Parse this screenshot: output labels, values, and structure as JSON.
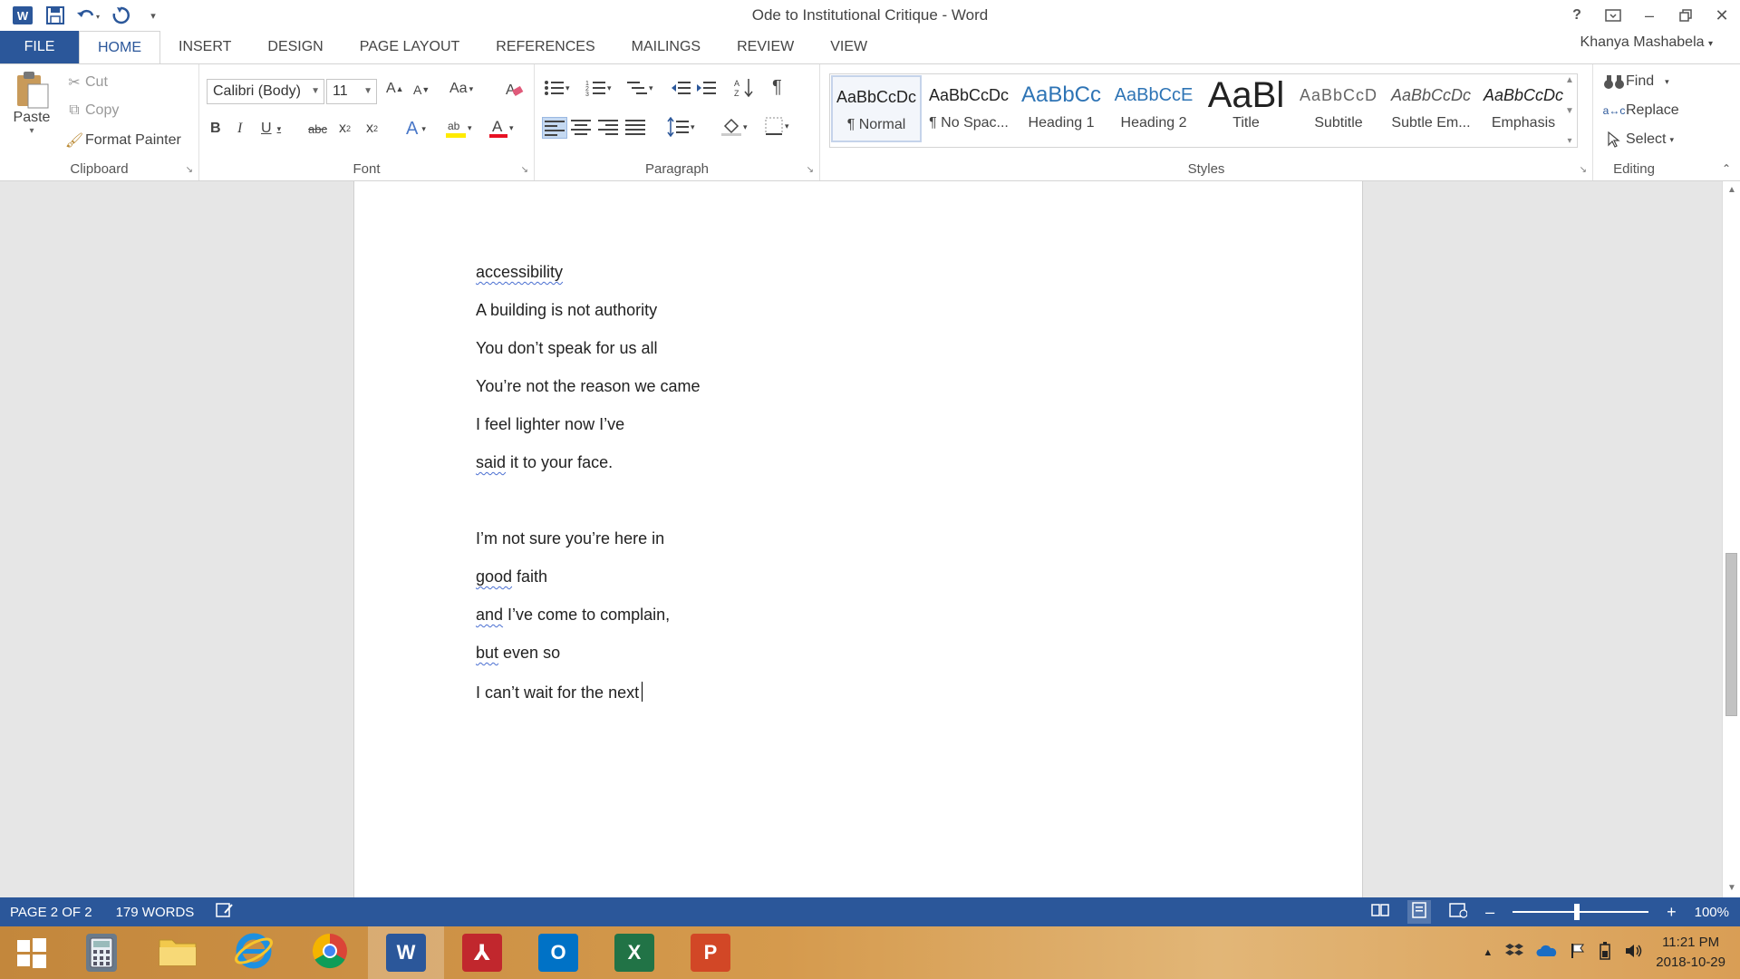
{
  "window": {
    "title": "Ode to Institutional Critique - Word",
    "user": "Khanya Mashabela"
  },
  "tabs": [
    {
      "label": "FILE"
    },
    {
      "label": "HOME"
    },
    {
      "label": "INSERT"
    },
    {
      "label": "DESIGN"
    },
    {
      "label": "PAGE LAYOUT"
    },
    {
      "label": "REFERENCES"
    },
    {
      "label": "MAILINGS"
    },
    {
      "label": "REVIEW"
    },
    {
      "label": "VIEW"
    }
  ],
  "clipboard": {
    "paste": "Paste",
    "cut": "Cut",
    "copy": "Copy",
    "format_painter": "Format Painter",
    "label": "Clipboard"
  },
  "font": {
    "name": "Calibri (Body)",
    "size": "11",
    "label": "Font"
  },
  "paragraph": {
    "label": "Paragraph"
  },
  "styles": {
    "label": "Styles",
    "items": [
      {
        "preview": "AaBbCcDc",
        "name": "¶ Normal"
      },
      {
        "preview": "AaBbCcDc",
        "name": "¶ No Spac..."
      },
      {
        "preview": "AaBbCc",
        "name": "Heading 1"
      },
      {
        "preview": "AaBbCcE",
        "name": "Heading 2"
      },
      {
        "preview": "AaBl",
        "name": "Title"
      },
      {
        "preview": "AaBbCcD",
        "name": "Subtitle"
      },
      {
        "preview": "AaBbCcDc",
        "name": "Subtle Em..."
      },
      {
        "preview": "AaBbCcDc",
        "name": "Emphasis"
      }
    ]
  },
  "editing": {
    "find": "Find",
    "replace": "Replace",
    "select": "Select",
    "label": "Editing"
  },
  "document": {
    "lines": [
      {
        "text": "accessibility",
        "squiggle": "accessibility",
        "rest": ""
      },
      {
        "text": "A building is not authority"
      },
      {
        "text": "You don’t speak for us all"
      },
      {
        "text": "You’re not the reason we came"
      },
      {
        "text": "I feel lighter now I’ve"
      },
      {
        "squiggle": "said",
        "rest": " it to your face."
      },
      {
        "text": "I’m not sure you’re here in"
      },
      {
        "squiggle": "good",
        "rest": " faith"
      },
      {
        "squiggle": "and",
        "rest": " I’ve come to complain,"
      },
      {
        "squiggle": "but",
        "rest": " even so"
      },
      {
        "text": "I can’t wait for the next"
      }
    ]
  },
  "status": {
    "page": "PAGE 2 OF 2",
    "words": "179 WORDS",
    "zoom": "100%",
    "zoom_level": 1.0
  },
  "taskbar": {
    "apps": [
      "start",
      "calculator",
      "file-explorer",
      "internet-explorer",
      "chrome",
      "word",
      "acrobat",
      "outlook",
      "excel",
      "powerpoint"
    ],
    "time": "11:21 PM",
    "date": "2018-10-29"
  }
}
